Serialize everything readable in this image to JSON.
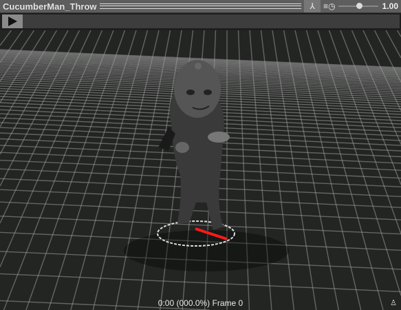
{
  "header": {
    "title": "CucumberMan_Throw",
    "speed_value": "1.00",
    "speed_fraction": 0.5,
    "icons": [
      "pivot-axes-icon",
      "speed-clock-icon"
    ]
  },
  "timeline": {
    "play_icon": "play-icon",
    "progress": 0.0
  },
  "viewport": {
    "status": "0:00 (000.0%) Frame 0",
    "corner_icon": "avatar-icon",
    "root_color": "#ff1a1a"
  }
}
